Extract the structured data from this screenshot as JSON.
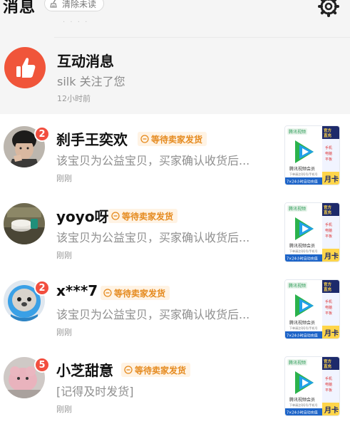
{
  "header": {
    "title": "消息",
    "clear_unread_label": "清除未读"
  },
  "interaction": {
    "title": "互动消息",
    "description": "silk 关注了您",
    "time": "12小时前"
  },
  "colors": {
    "badge_red": "#f24e3f",
    "tag_orange": "#e58a1e",
    "thumb_red": "#f0553a"
  },
  "product_card": {
    "brand": "腾讯视频",
    "title": "腾讯视频会员",
    "corner_top": "官方直充",
    "corner_mid": "手机 电脑 平板",
    "banner": "7×24小时自动充值",
    "month_label": "月卡",
    "small_line": "下单请注QQ号/手机号"
  },
  "conversations": [
    {
      "name": "刹手王奕欢",
      "unread": "2",
      "status": "等待卖家发货",
      "preview": "该宝贝为公益宝贝，买家确认收货后...",
      "time": "刚刚"
    },
    {
      "name": "yoyo呀",
      "unread": "",
      "status": "等待卖家发货",
      "preview": "该宝贝为公益宝贝，买家确认收货后...",
      "time": "刚刚"
    },
    {
      "name": "x***7",
      "unread": "2",
      "status": "等待卖家发货",
      "preview": "该宝贝为公益宝贝，买家确认收货后...",
      "time": "刚刚"
    },
    {
      "name": "小芝甜意",
      "unread": "5",
      "status": "等待卖家发货",
      "preview": "[记得及时发货]",
      "time": "刚刚"
    }
  ]
}
